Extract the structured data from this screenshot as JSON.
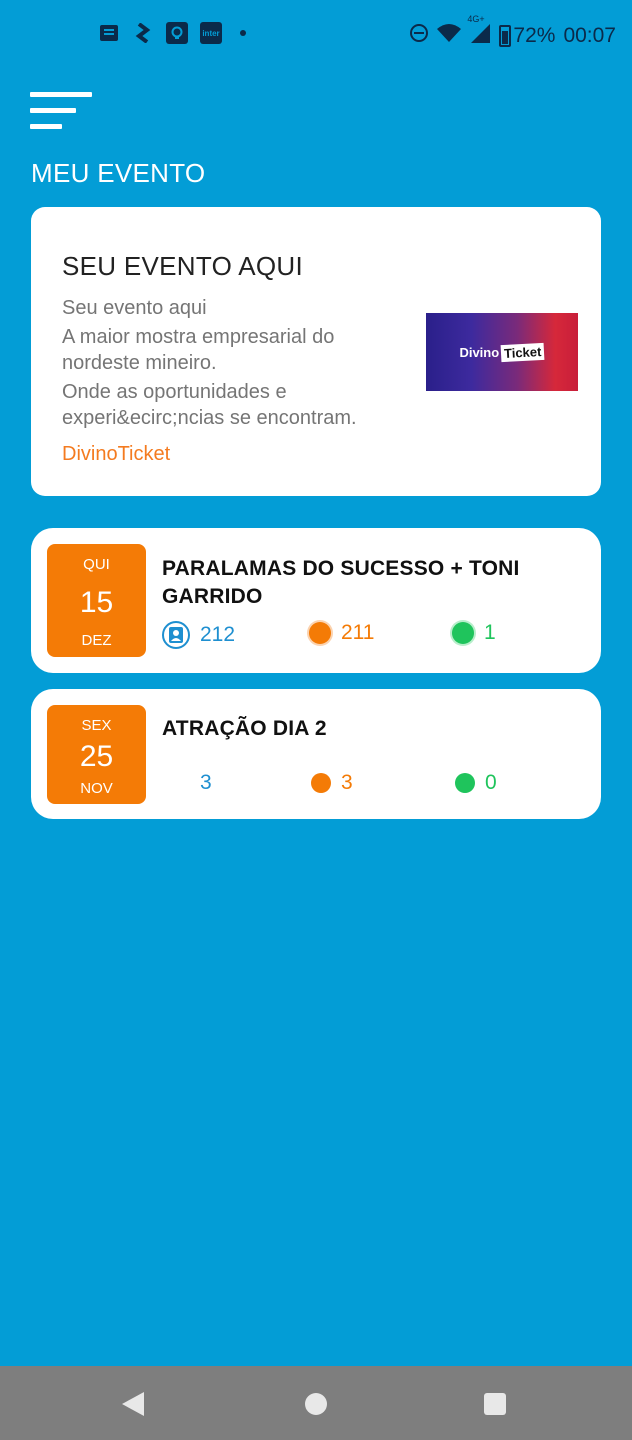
{
  "status_bar": {
    "battery": "72%",
    "time": "00:07",
    "network": "4G+",
    "icons": [
      "notification-icon",
      "dropbox-icon",
      "app-icon",
      "inter-icon",
      "dot-icon",
      "dnd-icon",
      "wifi-icon",
      "signal-icon",
      "battery-icon"
    ],
    "inter_label": "inter"
  },
  "header": {
    "section_title": "MEU EVENTO"
  },
  "event_card": {
    "title": "SEU EVENTO AQUI",
    "lines": [
      "Seu evento aqui",
      "A maior mostra empresarial do nordeste mineiro.",
      "Onde as oportunidades e experi&ecirc;ncias se encontram."
    ],
    "brand": "DivinoTicket",
    "banner_text_1": "Divino",
    "banner_text_2": "Ticket"
  },
  "shows": [
    {
      "dow": "QUI",
      "day": "15",
      "month": "DEZ",
      "title": "PARALAMAS DO SUCESSO + TONI GARRIDO",
      "stat_blue": "212",
      "stat_orange": "211",
      "stat_green": "1"
    },
    {
      "dow": "SEX",
      "day": "25",
      "month": "NOV",
      "title": "ATRAÇÃO DIA 2",
      "stat_blue": "3",
      "stat_orange": "3",
      "stat_green": "0"
    }
  ],
  "colors": {
    "background": "#039DD6",
    "accent_orange": "#F47B06",
    "stat_blue": "#1E8FD0",
    "stat_green": "#1FC45C",
    "navbar": "#7e7e7e"
  },
  "nav": {
    "icons": [
      "back-icon",
      "home-icon",
      "recent-apps-icon"
    ]
  }
}
